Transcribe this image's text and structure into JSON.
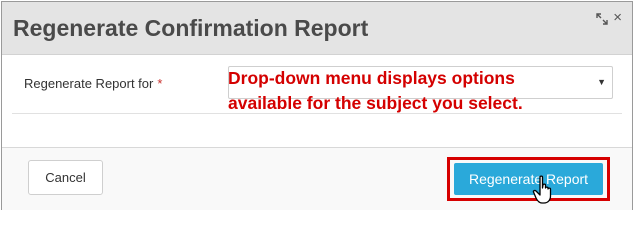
{
  "dialog": {
    "title": "Regenerate Confirmation Report",
    "expand_icon": "expand-icon",
    "close_glyph": "×"
  },
  "form": {
    "label": "Regenerate Report for",
    "required_mark": "*",
    "select_value": "",
    "caret": "▼"
  },
  "annotation": {
    "text": "Drop-down menu displays options\navailable for the subject you select."
  },
  "footer": {
    "cancel_label": "Cancel",
    "regenerate_label": "Regenerate Report"
  },
  "colors": {
    "header_bg": "#e4e4e4",
    "primary_button": "#2aa9da",
    "annotation_red": "#d40000"
  }
}
